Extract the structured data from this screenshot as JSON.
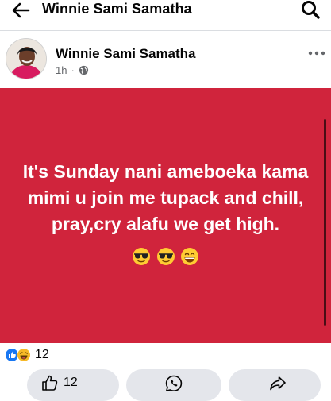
{
  "header": {
    "title": "Winnie Sami Samatha",
    "back_icon": "back-arrow-icon",
    "search_icon": "search-icon"
  },
  "post": {
    "author": "Winnie Sami Samatha",
    "time": "1h",
    "separator": "·",
    "privacy_icon": "globe-icon",
    "more_icon": "more-icon",
    "background_color": "#d0243c",
    "text": "It's Sunday nani ameboeka kama mimi u join me tupack and chill, pray,cry alafu we get high.",
    "emojis": [
      "sunglasses-emoji",
      "sunglasses-emoji",
      "grinning-emoji"
    ]
  },
  "reactions": {
    "icons": [
      "like-reaction-icon",
      "haha-reaction-icon"
    ],
    "count": "12"
  },
  "actions": {
    "like_count": "12",
    "like_icon": "thumbs-up-icon",
    "whatsapp_icon": "whatsapp-icon",
    "share_icon": "share-icon"
  },
  "colors": {
    "post_background": "#d0243c",
    "like_blue": "#1877f2",
    "button_gray": "#e4e6eb"
  }
}
